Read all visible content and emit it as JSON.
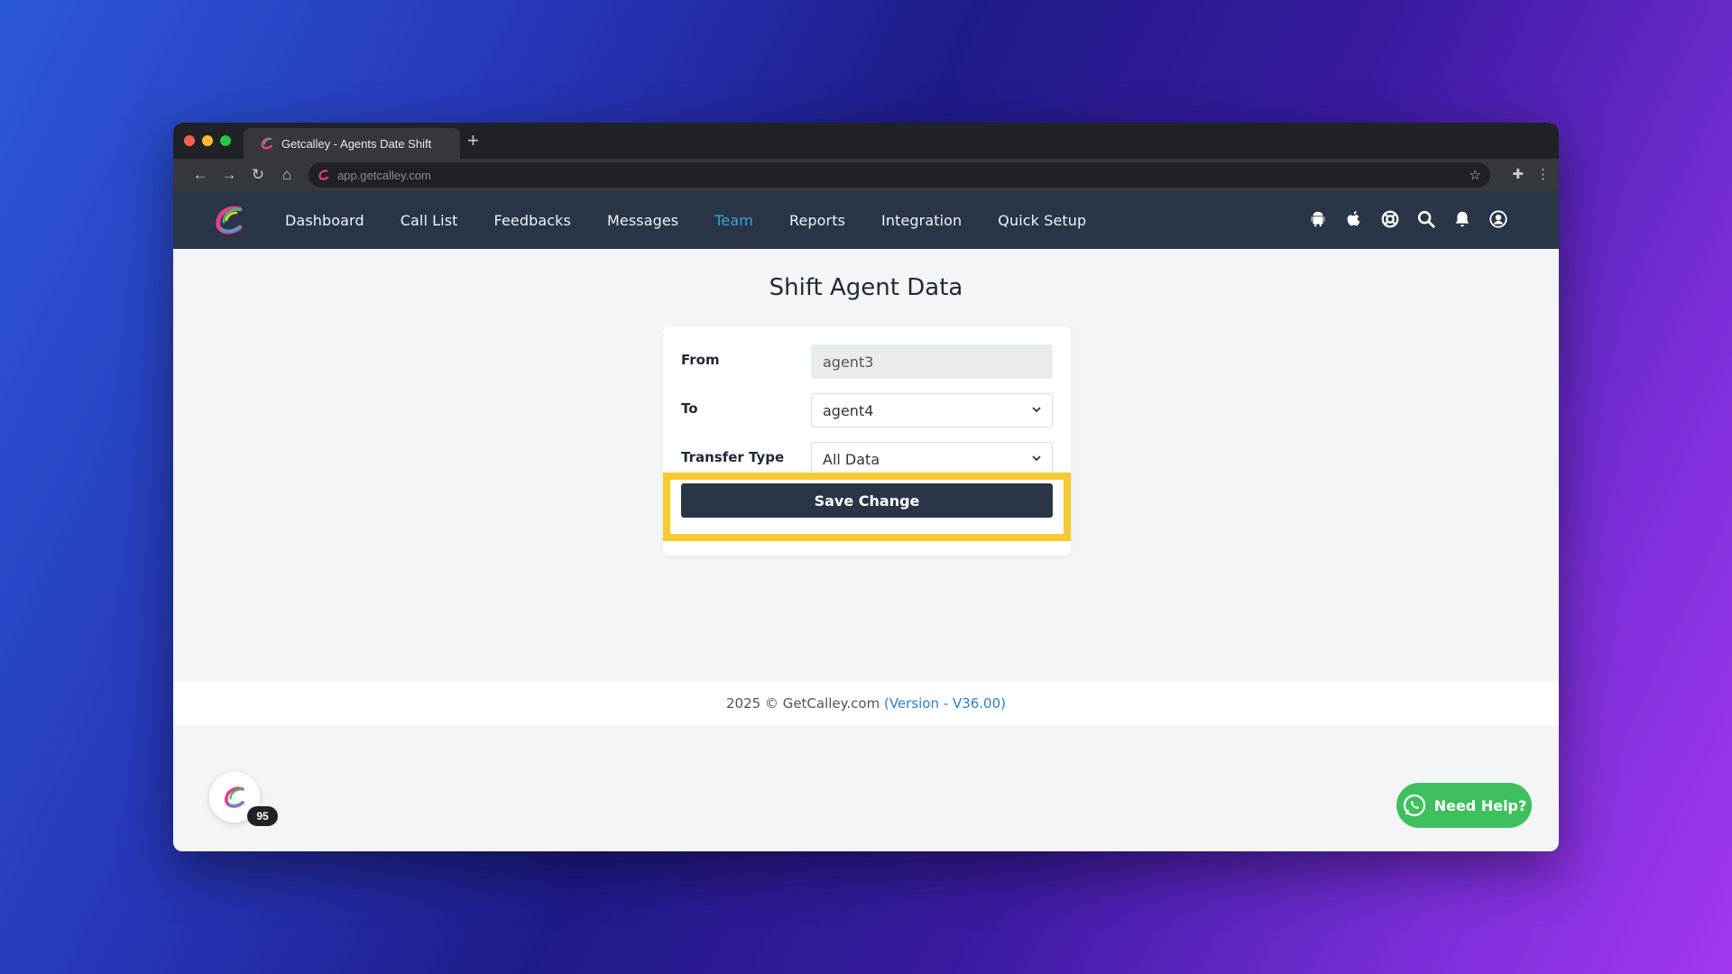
{
  "browser": {
    "tab_title": "Getcalley - Agents Date Shift",
    "new_tab_glyph": "+",
    "url": "app.getcalley.com"
  },
  "nav": {
    "items": [
      {
        "label": "Dashboard",
        "active": false
      },
      {
        "label": "Call List",
        "active": false
      },
      {
        "label": "Feedbacks",
        "active": false
      },
      {
        "label": "Messages",
        "active": false
      },
      {
        "label": "Team",
        "active": true
      },
      {
        "label": "Reports",
        "active": false
      },
      {
        "label": "Integration",
        "active": false
      },
      {
        "label": "Quick Setup",
        "active": false
      }
    ],
    "icons": [
      "android-icon",
      "apple-icon",
      "support-icon",
      "search-icon",
      "bell-icon",
      "user-icon"
    ]
  },
  "page": {
    "title": "Shift Agent Data"
  },
  "form": {
    "from_label": "From",
    "from_value": "agent3",
    "to_label": "To",
    "to_value": "agent4",
    "transfer_label": "Transfer Type",
    "transfer_value": "All Data",
    "save_label": "Save Change"
  },
  "footer": {
    "copyright": "2025 © GetCalley.com",
    "version": "(Version - V36.00)"
  },
  "widgets": {
    "badge_count": "95",
    "help_label": "Need Help?"
  },
  "colors": {
    "nav_bg": "#2a3647",
    "active_nav": "#36a6d6",
    "highlight": "#f7cb2f",
    "help_green": "#3fc05e"
  }
}
